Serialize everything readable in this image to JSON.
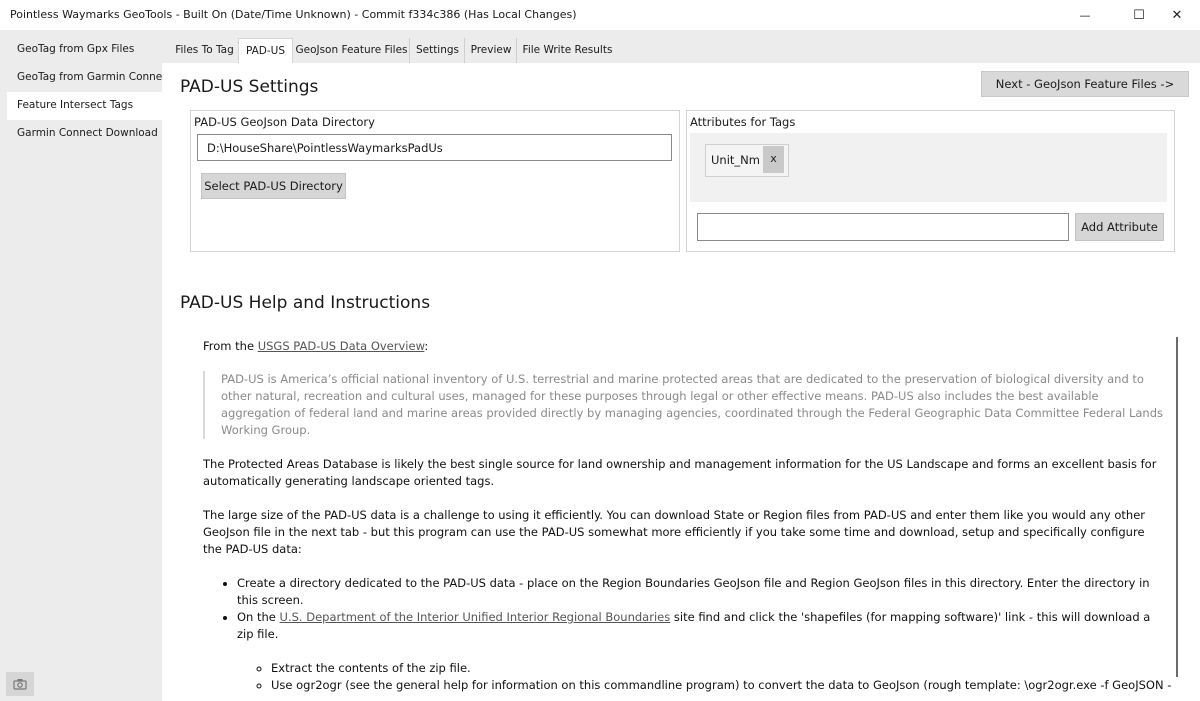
{
  "window": {
    "title": "Pointless Waymarks GeoTools - Built On (Date/Time Unknown) - Commit f334c386 (Has Local Changes)",
    "minimize_glyph": "—",
    "maximize_glyph": "☐",
    "close_glyph": "✕"
  },
  "sidebar": {
    "items": [
      {
        "label": "GeoTag from Gpx Files"
      },
      {
        "label": "GeoTag from Garmin Connect"
      },
      {
        "label": "Feature Intersect Tags"
      },
      {
        "label": "Garmin Connect Download"
      }
    ],
    "selected_index": 2,
    "camera_icon": "camera-icon"
  },
  "tabs": [
    {
      "label": "Files To Tag"
    },
    {
      "label": "PAD-US"
    },
    {
      "label": "GeoJson Feature Files"
    },
    {
      "label": "Settings"
    },
    {
      "label": "Preview"
    },
    {
      "label": "File Write Results"
    }
  ],
  "active_tab_index": 1,
  "settings": {
    "heading": "PAD-US Settings",
    "next_button": "Next - GeoJson Feature Files ->",
    "directory_label": "PAD-US GeoJson Data Directory",
    "directory_value": "D:\\HouseShare\\PointlessWaymarksPadUs",
    "select_button": "Select PAD-US Directory",
    "attributes_label": "Attributes for Tags",
    "attributes": [
      {
        "name": "Unit_Nm",
        "remove": "x"
      }
    ],
    "new_attribute_value": "",
    "add_attribute_button": "Add Attribute"
  },
  "help": {
    "heading": "PAD-US Help and Instructions",
    "from_prefix": "From the ",
    "overview_link": "USGS PAD-US Data Overview",
    "from_suffix": ":",
    "quote": "PAD-US is America’s official national inventory of U.S. terrestrial and marine protected areas that are dedicated to the preservation of biological diversity and to other natural, recreation and cultural uses, managed for these purposes through legal or other effective means. PAD-US also includes the best available aggregation of federal land and marine areas provided directly by managing agencies, coordinated through the Federal Geographic Data Committee Federal Lands Working Group.",
    "para1": "The Protected Areas Database is likely the best single source for land ownership and management information for the US Landscape and forms an excellent basis for automatically generating landscape oriented tags.",
    "para2": "The large size of the PAD-US data is a challenge to using it efficiently. You can download State or Region files from PAD-US and enter them like you would any other GeoJson file in the next tab - but this program can use the PAD-US somewhat more efficiently if you take some time and download, setup and specifically configure the PAD-US data:",
    "bullet1": "Create a directory dedicated to the PAD-US data - place on the Region Boundaries GeoJson file and Region GeoJson files in this directory. Enter the directory in this screen.",
    "bullet2_prefix": "On the ",
    "bullet2_link": "U.S. Department of the Interior Unified Interior Regional Boundaries",
    "bullet2_suffix": " site find and click the 'shapefiles (for mapping software)' link - this will download a zip file.",
    "sub1": "Extract the contents of the zip file.",
    "sub2": "Use ogr2ogr (see the general help for information on this commandline program) to convert the data to GeoJson (rough template: \\ogr2ogr.exe -f GeoJSON -"
  }
}
